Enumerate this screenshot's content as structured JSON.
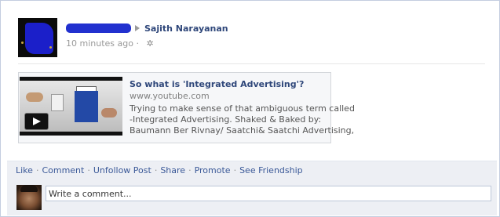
{
  "story": {
    "poster_name": "Sajith Narayanan",
    "timestamp": "10 minutes ago",
    "separator": "·"
  },
  "attachment": {
    "title": "So what is 'Integrated Advertising'?",
    "source": "www.youtube.com",
    "description_lines": [
      "Trying to make sense of that ambiguous term called",
      "-Integrated Advertising. Shaked & Baked by:",
      "Baumann Ber Rivnay/ Saatchi& Saatchi Advertising,"
    ]
  },
  "actions": {
    "like": "Like",
    "comment": "Comment",
    "unfollow": "Unfollow Post",
    "share": "Share",
    "promote": "Promote",
    "see_friendship": "See Friendship",
    "dot": "·"
  },
  "comment_box": {
    "placeholder": "Write a comment..."
  },
  "icons": {
    "arrow": "right-triangle-icon",
    "gear": "gear-icon",
    "play": "play-icon"
  },
  "colors": {
    "link": "#3b5998",
    "name": "#2f477a",
    "panel_bg": "#edeff4"
  }
}
